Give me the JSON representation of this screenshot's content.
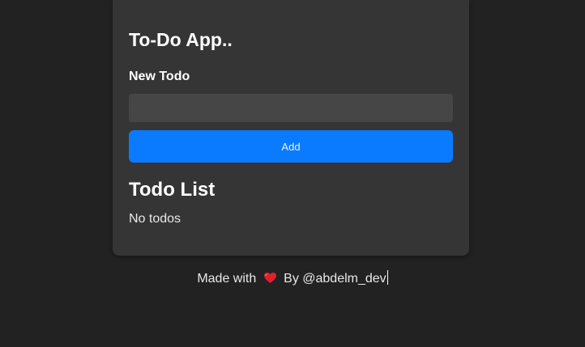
{
  "app": {
    "title": "To-Do App..",
    "new_todo_label": "New Todo",
    "input_value": "",
    "add_button_label": "Add",
    "list_title": "Todo List",
    "empty_message": "No todos"
  },
  "footer": {
    "prefix": "Made with",
    "heart_icon": "heart-icon",
    "suffix": "By @abdelm_dev"
  },
  "colors": {
    "background": "#222222",
    "card": "#353535",
    "input": "#464646",
    "accent": "#0a7bff",
    "heart": "#e0202f"
  }
}
